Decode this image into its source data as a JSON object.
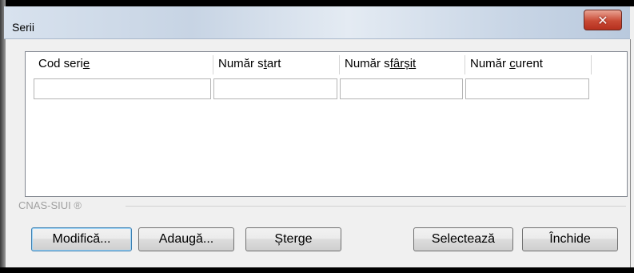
{
  "window": {
    "title": "Serii",
    "close_glyph": "✕"
  },
  "columns": [
    {
      "label": "Cod seri",
      "mnemonic": "e",
      "rest": ""
    },
    {
      "label": "Număr s",
      "mnemonic": "t",
      "rest": "art"
    },
    {
      "label": "Număr s",
      "mnemonic": "fârșit",
      "rest": ""
    },
    {
      "label": "Număr ",
      "mnemonic": "c",
      "rest": "urent"
    }
  ],
  "group_label": "CNAS-SIUI ®",
  "buttons": {
    "modifica": "Modifică...",
    "adauga": "Adaugă...",
    "sterge": "Șterge",
    "selecteaza": "Selectează",
    "inchide": "Închide"
  }
}
